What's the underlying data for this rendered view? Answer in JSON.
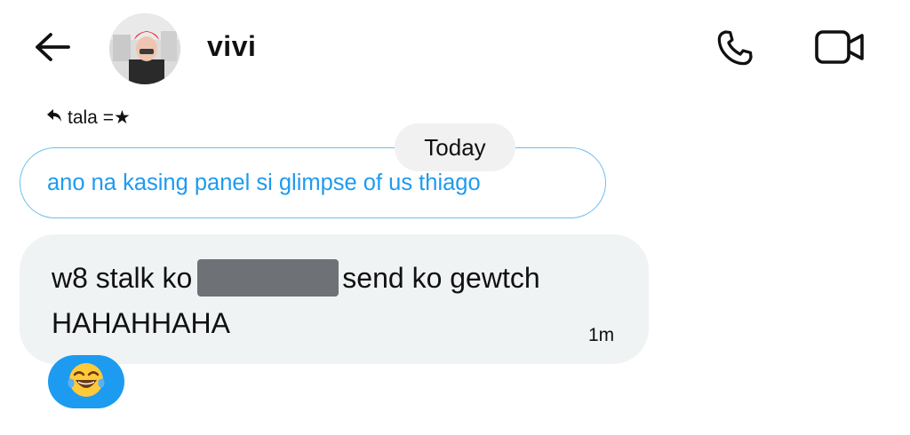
{
  "header": {
    "username": "vivi"
  },
  "reply": {
    "label": "tala =★"
  },
  "date_divider": "Today",
  "quoted_message": "ano na kasing panel si glimpse of us thiago",
  "message": {
    "text_before_redaction": "w8 stalk ko",
    "text_after_redaction": "send ko gewtch",
    "line2": "HAHAHHAHA",
    "time": "1m"
  },
  "reaction": {
    "emoji": "😂"
  },
  "colors": {
    "accent": "#1d9bf0",
    "bubble": "#eff3f4",
    "pill": "#f1f1f2"
  }
}
